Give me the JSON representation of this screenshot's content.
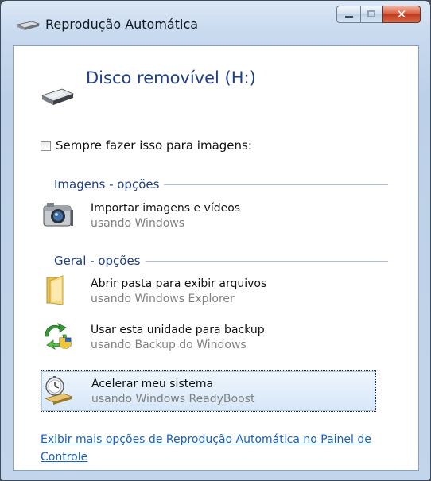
{
  "window": {
    "title": "Reprodução Automática",
    "title_icon": "drive-icon"
  },
  "device": {
    "name": "Disco removível (H:)",
    "icon": "removable-drive-icon"
  },
  "always_checkbox": {
    "label": "Sempre fazer isso para imagens:",
    "checked": false
  },
  "groups": [
    {
      "header": "Imagens - opções",
      "options": [
        {
          "title": "Importar imagens e vídeos",
          "subtitle": "usando Windows",
          "icon": "camera-icon",
          "selected": false
        }
      ]
    },
    {
      "header": "Geral - opções",
      "options": [
        {
          "title": "Abrir pasta para exibir arquivos",
          "subtitle": "usando Windows Explorer",
          "icon": "folder-icon",
          "selected": false
        },
        {
          "title": "Usar esta unidade para backup",
          "subtitle": "usando Backup do Windows",
          "icon": "backup-icon",
          "selected": false
        },
        {
          "title": "Acelerar meu sistema",
          "subtitle": "usando Windows ReadyBoost",
          "icon": "readyboost-icon",
          "selected": true
        }
      ]
    }
  ],
  "footer": {
    "link": "Exibir mais opções de Reprodução Automática no Painel de Controle"
  },
  "colors": {
    "heading_blue": "#1f3f86",
    "link_blue": "#1560c4",
    "close_red": "#c2381b"
  }
}
